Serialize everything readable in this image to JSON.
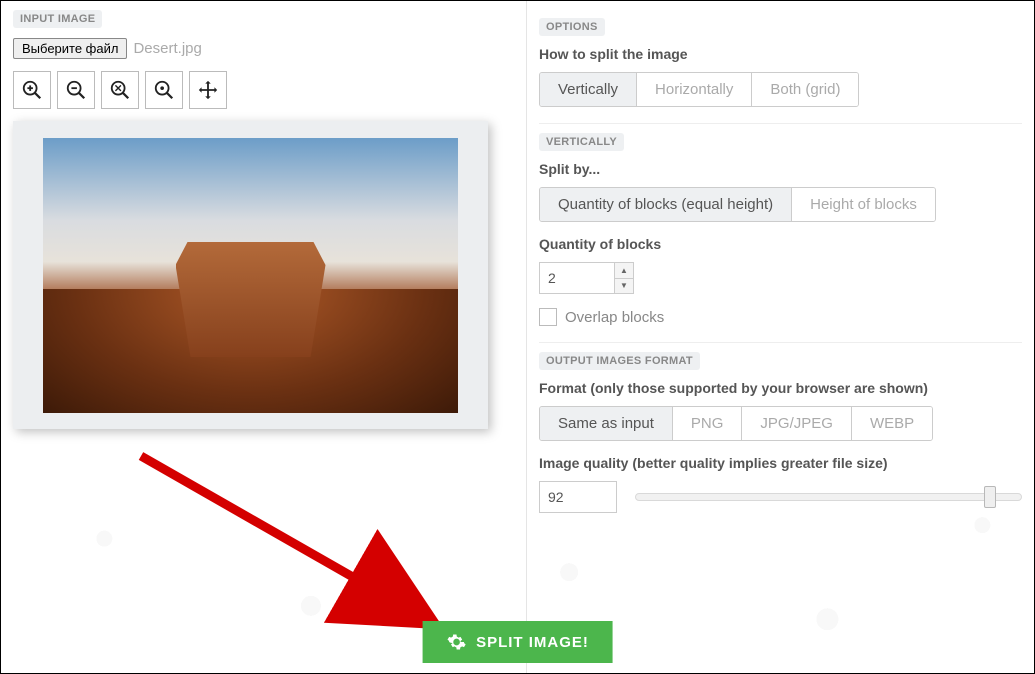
{
  "left": {
    "header": "INPUT IMAGE",
    "file_button": "Выберите файл",
    "file_name": "Desert.jpg"
  },
  "options": {
    "header": "OPTIONS",
    "how_label": "How to split the image",
    "how_opts": {
      "vertically": "Vertically",
      "horizontally": "Horizontally",
      "both": "Both (grid)"
    }
  },
  "vertically": {
    "header": "VERTICALLY",
    "split_by_label": "Split by...",
    "split_by_opts": {
      "qty": "Quantity of blocks (equal height)",
      "height": "Height of blocks"
    },
    "qty_label": "Quantity of blocks",
    "qty_value": "2",
    "overlap_label": "Overlap blocks"
  },
  "format": {
    "header": "OUTPUT IMAGES FORMAT",
    "format_label": "Format (only those supported by your browser are shown)",
    "fmt_opts": {
      "same": "Same as input",
      "png": "PNG",
      "jpg": "JPG/JPEG",
      "webp": "WEBP"
    },
    "quality_label": "Image quality (better quality implies greater file size)",
    "quality_value": "92"
  },
  "action": {
    "split_label": "SPLIT IMAGE!"
  }
}
